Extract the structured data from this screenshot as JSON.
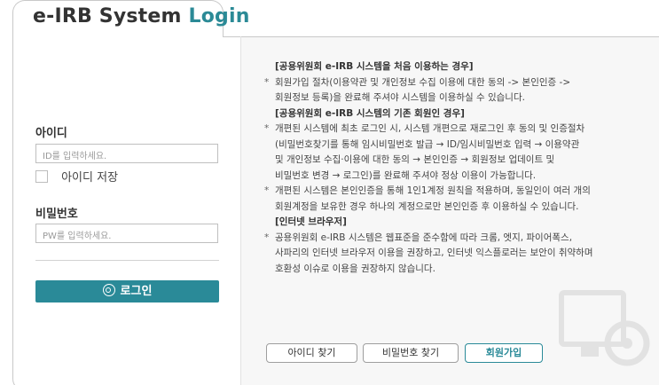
{
  "tab": {
    "title_part1": "e-IRB System",
    "title_part2": "Login"
  },
  "login": {
    "id_label": "아이디",
    "id_placeholder": "ID를 입력하세요.",
    "remember_label": "아이디 저장",
    "pw_label": "비밀번호",
    "pw_placeholder": "PW를 입력하세요.",
    "login_button": "로그인"
  },
  "info": {
    "heading1": "[공용위원회 e-IRB 시스템을 처음 이용하는 경우]",
    "bullet1": [
      "회원가입 절차(이용약관 및 개인정보 수집 이용에 대한 동의 -> 본인인증 ->",
      "회원정보 등록)을 완료해 주셔야 시스템을 이용하실 수 있습니다."
    ],
    "heading2": "[공용위원회 e-IRB 시스템의 기존 회원인 경우]",
    "bullet2": [
      "개편된 시스템에 최초 로그인 시, 시스템 개편으로 재로그인 후 동의 및 인증절차",
      "(비밀번호찾기를 통해 임시비밀번호 발급 → ID/임시비밀번호 입력 → 이용약관",
      "및 개인정보 수집·이용에 대한 동의 → 본인인증 → 회원정보 업데이트 및",
      "비밀번호 변경 → 로그인)를 완료해 주셔야 정상 이용이 가능합니다."
    ],
    "bullet3": [
      "개편된 시스템은 본인인증을 통해 1인1계정 원칙을 적용하며, 동일인이 여러 개의",
      "회원계정을 보유한 경우 하나의 계정으로만 본인인증 후 이용하실 수 있습니다."
    ],
    "heading3": "[인터넷 브라우저]",
    "bullet4": [
      "공용위원회 e-IRB 시스템은 웹표준을 준수함에 따라 크롬, 엣지, 파이어폭스,",
      "사파리의 인터넷 브라우저 이용을 권장하고, 인터넷 익스플로러는 보안이 취약하며",
      "호환성 이슈로 이용을 권장하지 않습니다."
    ]
  },
  "buttons": {
    "find_id": "아이디 찾기",
    "find_pw": "비밀번호 찾기",
    "signup": "회원가입"
  },
  "colors": {
    "accent": "#2a8a98",
    "title_accent": "#2b8a96",
    "border": "#c9c9c9",
    "info_bg": "#f7f7f7"
  }
}
